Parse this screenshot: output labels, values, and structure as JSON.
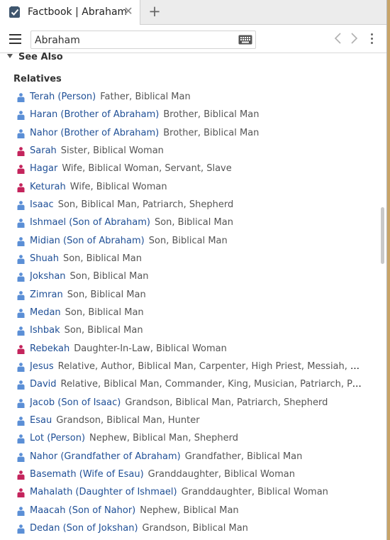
{
  "tab": {
    "title": "Factbook | Abraham",
    "close_glyph": "✕",
    "add_glyph": "+"
  },
  "search": {
    "value": "Abraham",
    "placeholder": ""
  },
  "section": {
    "title": "See Also",
    "group_title": "Relatives"
  },
  "colors": {
    "male": "#5b8fd6",
    "female": "#c4245c",
    "link": "#1f4f96",
    "background": "#c8a468"
  },
  "relatives": [
    {
      "name": "Terah (Person)",
      "desc": "Father, Biblical Man",
      "gender": "male"
    },
    {
      "name": "Haran (Brother of Abraham)",
      "desc": "Brother, Biblical Man",
      "gender": "male"
    },
    {
      "name": "Nahor (Brother of Abraham)",
      "desc": "Brother, Biblical Man",
      "gender": "male"
    },
    {
      "name": "Sarah",
      "desc": "Sister, Biblical Woman",
      "gender": "female"
    },
    {
      "name": "Hagar",
      "desc": "Wife, Biblical Woman, Servant, Slave",
      "gender": "female"
    },
    {
      "name": "Keturah",
      "desc": "Wife, Biblical Woman",
      "gender": "female"
    },
    {
      "name": "Isaac",
      "desc": "Son, Biblical Man, Patriarch, Shepherd",
      "gender": "male"
    },
    {
      "name": "Ishmael (Son of Abraham)",
      "desc": "Son, Biblical Man",
      "gender": "male"
    },
    {
      "name": "Midian (Son of Abraham)",
      "desc": "Son, Biblical Man",
      "gender": "male"
    },
    {
      "name": "Shuah",
      "desc": "Son, Biblical Man",
      "gender": "male"
    },
    {
      "name": "Jokshan",
      "desc": "Son, Biblical Man",
      "gender": "male"
    },
    {
      "name": "Zimran",
      "desc": "Son, Biblical Man",
      "gender": "male"
    },
    {
      "name": "Medan",
      "desc": "Son, Biblical Man",
      "gender": "male"
    },
    {
      "name": "Ishbak",
      "desc": "Son, Biblical Man",
      "gender": "male"
    },
    {
      "name": "Rebekah",
      "desc": "Daughter-In-Law, Biblical Woman",
      "gender": "female"
    },
    {
      "name": "Jesus",
      "desc": "Relative, Author, Biblical Man, Carpenter, High Priest, Messiah, Pers…",
      "gender": "male"
    },
    {
      "name": "David",
      "desc": "Relative, Biblical Man, Commander, King, Musician, Patriarch, Psal…",
      "gender": "male"
    },
    {
      "name": "Jacob (Son of Isaac)",
      "desc": "Grandson, Biblical Man, Patriarch, Shepherd",
      "gender": "male"
    },
    {
      "name": "Esau",
      "desc": "Grandson, Biblical Man, Hunter",
      "gender": "male"
    },
    {
      "name": "Lot (Person)",
      "desc": "Nephew, Biblical Man, Shepherd",
      "gender": "male"
    },
    {
      "name": "Nahor (Grandfather of Abraham)",
      "desc": "Grandfather, Biblical Man",
      "gender": "male"
    },
    {
      "name": "Basemath (Wife of Esau)",
      "desc": "Granddaughter, Biblical Woman",
      "gender": "female"
    },
    {
      "name": "Mahalath (Daughter of Ishmael)",
      "desc": "Granddaughter, Biblical Woman",
      "gender": "female"
    },
    {
      "name": "Maacah (Son of Nahor)",
      "desc": "Nephew, Biblical Man",
      "gender": "male"
    },
    {
      "name": "Dedan (Son of Jokshan)",
      "desc": "Grandson, Biblical Man",
      "gender": "male"
    }
  ]
}
